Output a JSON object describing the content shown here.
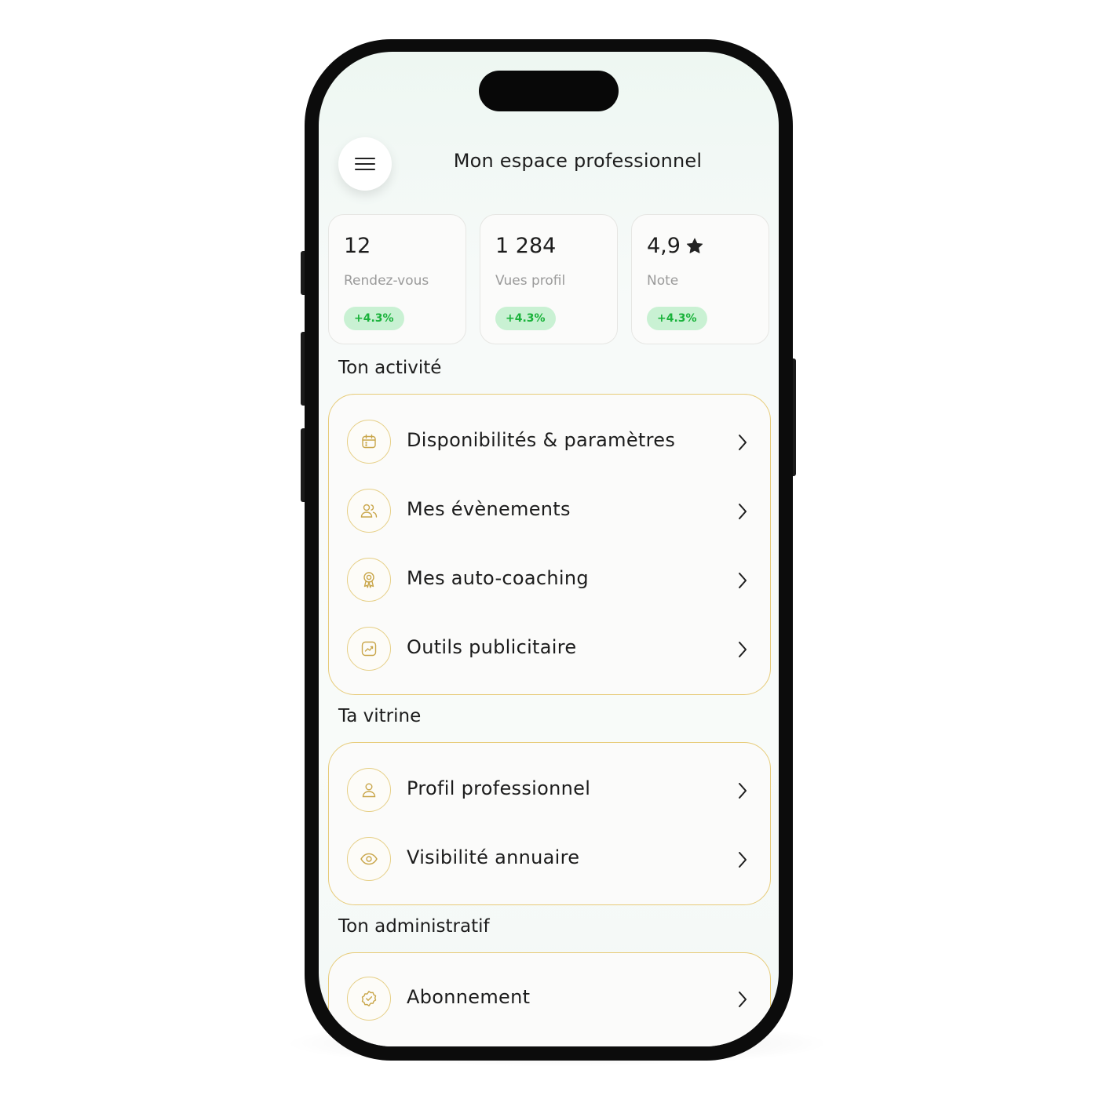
{
  "header": {
    "menu_icon": "hamburger-menu-icon",
    "title": "Mon espace professionnel"
  },
  "stats": [
    {
      "value": "12",
      "label": "Rendez-vous",
      "badge": "+4.3%"
    },
    {
      "value": "1 284",
      "label": "Vues profil",
      "badge": "+4.3%"
    },
    {
      "value": "4,9",
      "label": "Note",
      "badge": "+4.3%",
      "icon": "star-icon"
    }
  ],
  "sections": [
    {
      "title": "Ton activité",
      "items": [
        {
          "label": "Disponibilités & paramètres",
          "icon": "calendar-icon"
        },
        {
          "label": "Mes évènements",
          "icon": "users-icon"
        },
        {
          "label": "Mes auto-coaching",
          "icon": "award-icon"
        },
        {
          "label": "Outils publicitaire",
          "icon": "chart-trend-icon"
        }
      ]
    },
    {
      "title": "Ta vitrine",
      "items": [
        {
          "label": "Profil professionnel",
          "icon": "user-icon"
        },
        {
          "label": "Visibilité annuaire",
          "icon": "eye-icon"
        }
      ]
    },
    {
      "title": "Ton administratif",
      "items": [
        {
          "label": "Abonnement",
          "icon": "verified-badge-icon"
        }
      ]
    }
  ],
  "colors": {
    "accent_border": "#e7cb78",
    "icon_gold": "#c9a64a",
    "badge_bg": "#c9f1d3",
    "badge_text": "#19b23a"
  }
}
